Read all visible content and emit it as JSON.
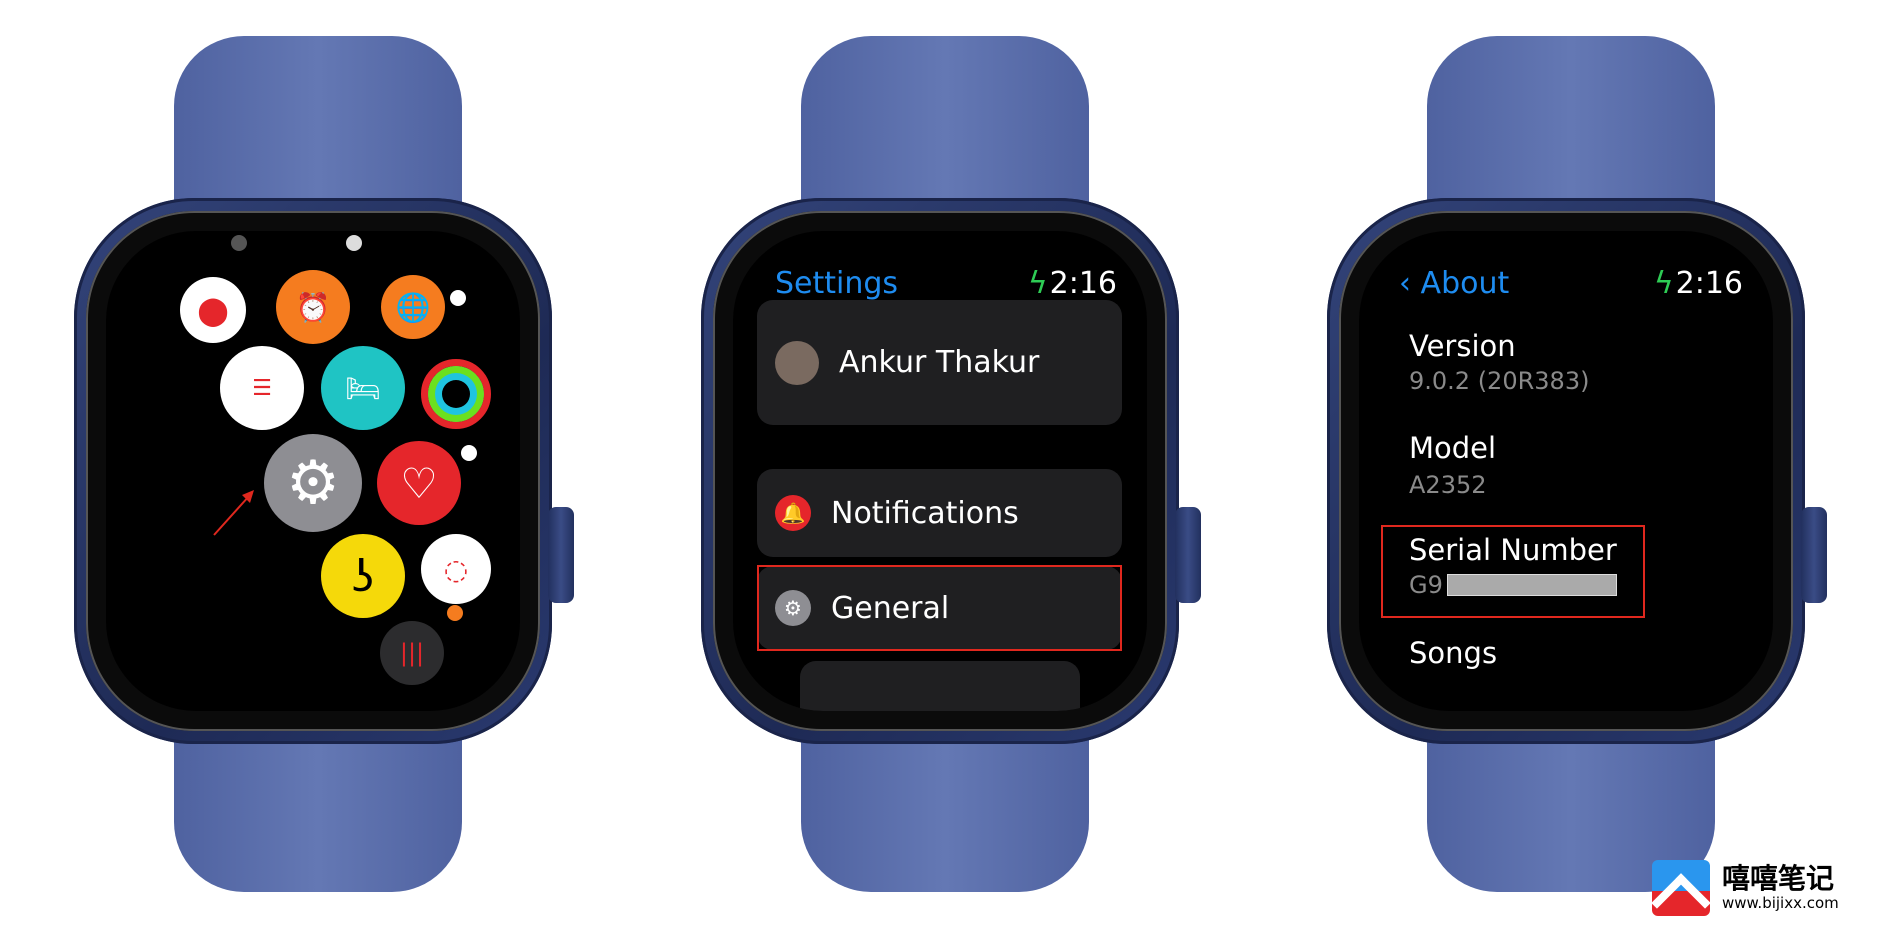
{
  "watch1": {
    "screen": "app-grid",
    "apps": [
      {
        "name": "google-maps",
        "icon": "map-pin-icon",
        "color": "#ffffff"
      },
      {
        "name": "alarms",
        "icon": "alarm-clock-icon",
        "color": "#f57c1f"
      },
      {
        "name": "world-clock",
        "icon": "globe-icon",
        "color": "#f57c1f"
      },
      {
        "name": "reminders",
        "icon": "list-icon",
        "color": "#ffffff"
      },
      {
        "name": "sleep",
        "icon": "bed-icon",
        "color": "#1fc4c4"
      },
      {
        "name": "activity",
        "icon": "activity-rings-icon",
        "color": "#000000"
      },
      {
        "name": "settings",
        "icon": "gear-icon",
        "color": "#8e8e93"
      },
      {
        "name": "heart-rate",
        "icon": "heart-icon",
        "color": "#e5262b"
      },
      {
        "name": "noise",
        "icon": "ear-icon",
        "color": "#f5d90a"
      },
      {
        "name": "loading",
        "icon": "spinner-icon",
        "color": "#ffffff"
      },
      {
        "name": "voice-memos",
        "icon": "waveform-icon",
        "color": "#2c2c2e"
      }
    ],
    "arrow_color": "#e0281e"
  },
  "watch2": {
    "title": "Settings",
    "time": "2:16",
    "profile_name": "Ankur Thakur",
    "items": [
      {
        "label": "Notifications",
        "icon": "bell-icon",
        "color": "#e5262b"
      },
      {
        "label": "General",
        "icon": "gear-icon",
        "color": "#8e8e93"
      }
    ],
    "highlight": "General"
  },
  "watch3": {
    "back": "About",
    "time": "2:16",
    "rows": [
      {
        "label": "Version",
        "value": "9.0.2 (20R383)"
      },
      {
        "label": "Model",
        "value": "A2352"
      },
      {
        "label": "Serial Number",
        "value": "G9"
      },
      {
        "label": "Songs"
      }
    ],
    "highlight": "Serial Number"
  },
  "watermark": {
    "name": "嘻嘻笔记",
    "url": "www.bijixx.com"
  },
  "colors": {
    "accent": "#1e8cf0",
    "charging": "#2ecc55",
    "highlight": "#e0281e",
    "band": "#5a6eab"
  }
}
